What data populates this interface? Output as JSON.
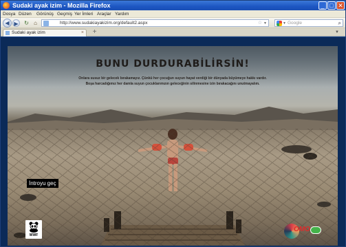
{
  "window": {
    "title": "Sudaki ayak izim - Mozilla Firefox",
    "controls": {
      "minimize": "_",
      "maximize": "□",
      "close": "✕"
    }
  },
  "menubar": {
    "items": [
      "Dosya",
      "Düzen",
      "Görünüş",
      "Geçmiş",
      "Yer İmleri",
      "Araçlar",
      "Yardım"
    ]
  },
  "navbar": {
    "back_icon": "arrow-left",
    "forward_icon": "arrow-right",
    "reload_icon": "reload",
    "home_icon": "home",
    "url": "http://www.sudakiayakizim.org/default2.aspx",
    "search_placeholder": "Google"
  },
  "tabs": {
    "items": [
      {
        "label": "Sudaki ayak izim"
      }
    ],
    "new_tab_symbol": "+"
  },
  "page": {
    "headline": "BUNU DURDURABİLİRSİN!",
    "subtext_line1": "Onlara susuz bir gelecek bırakamayız. Çünkü her çocuğun suyun hayat verdiği bir dünyada büyümeye hakkı vardır.",
    "subtext_line2": "Boşa harcadığımız her damla suyun çocuklarımızın geleceğinin silinmesine izin bırakacağını unutmayalım.",
    "skip_intro": "İntroyu geç",
    "wwf_logo_text": "WWF",
    "omo_logo_text": "OMO"
  },
  "colors": {
    "titlebar": "#1d56c2",
    "menubar": "#ece9d8",
    "page_bg": "#0b2a58",
    "headline": "#1f1c1a"
  }
}
